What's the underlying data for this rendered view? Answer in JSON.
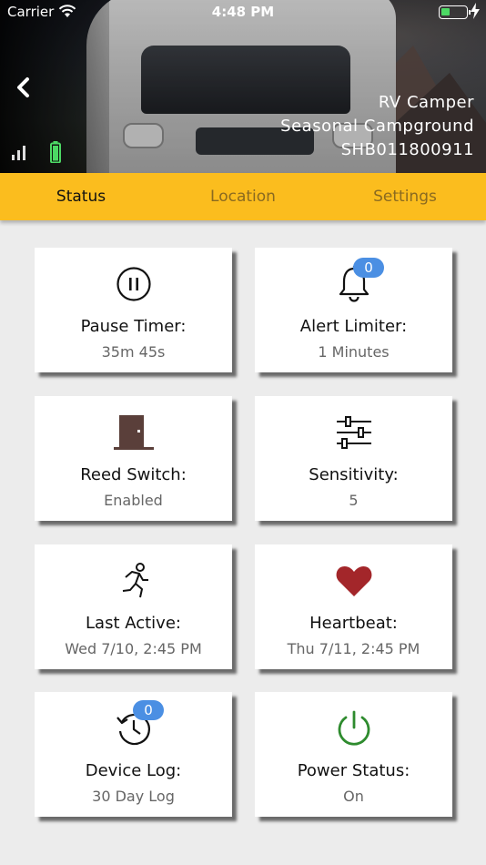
{
  "status_bar": {
    "carrier": "Carrier",
    "time": "4:48 PM",
    "battery_color": "#4cd964"
  },
  "header": {
    "back_icon": "chevron-left-icon",
    "device_name": "RV Camper",
    "location": "Seasonal Campground",
    "serial": "SHB011800911",
    "signal_icon": "signal-bars-icon",
    "battery_icon": "battery-icon",
    "battery_color": "#4cd964"
  },
  "tabs": [
    {
      "label": "Status",
      "active": true
    },
    {
      "label": "Location",
      "active": false
    },
    {
      "label": "Settings",
      "active": false
    }
  ],
  "accent_color": "#fbbd1e",
  "cards": {
    "pause_timer": {
      "icon": "pause-circle-icon",
      "title": "Pause Timer:",
      "value": "35m 45s"
    },
    "alert_limiter": {
      "icon": "bell-icon",
      "title": "Alert Limiter:",
      "value": "1 Minutes",
      "badge": "0"
    },
    "reed_switch": {
      "icon": "door-icon",
      "title": "Reed Switch:",
      "value": "Enabled"
    },
    "sensitivity": {
      "icon": "sliders-icon",
      "title": "Sensitivity:",
      "value": "5"
    },
    "last_active": {
      "icon": "running-person-icon",
      "title": "Last Active:",
      "value": "Wed 7/10, 2:45 PM"
    },
    "heartbeat": {
      "icon": "heart-icon",
      "title": "Heartbeat:",
      "value": "Thu 7/11, 2:45 PM",
      "color": "#a3262a"
    },
    "device_log": {
      "icon": "history-icon",
      "title": "Device Log:",
      "value": "30 Day Log",
      "badge": "0"
    },
    "power_status": {
      "icon": "power-icon",
      "title": "Power Status:",
      "value": "On",
      "color": "#2e8b2e"
    }
  }
}
